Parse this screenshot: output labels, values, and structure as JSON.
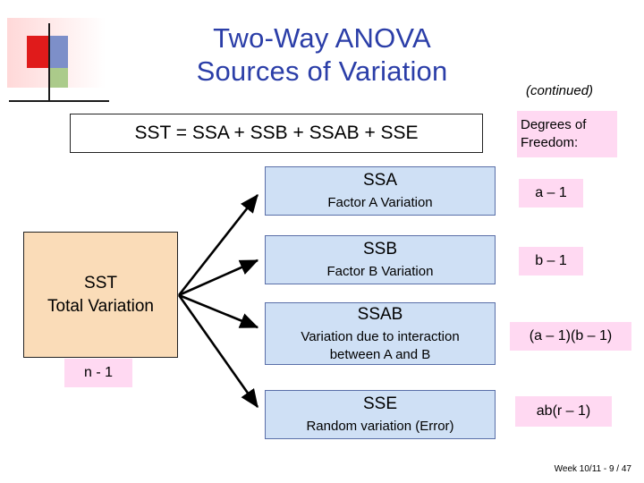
{
  "slide": {
    "title_line1": "Two-Way ANOVA",
    "title_line2": "Sources of Variation",
    "continued_note": "(continued)",
    "equation": "SST = SSA + SSB + SSAB + SSE",
    "footer": "Week 10/11 - 9 / 47"
  },
  "source_box": {
    "name": "SST",
    "description": "Total Variation",
    "df": "n - 1"
  },
  "components": [
    {
      "name": "SSA",
      "description": "Factor A Variation",
      "df": "a – 1"
    },
    {
      "name": "SSB",
      "description": "Factor B Variation",
      "df": "b – 1"
    },
    {
      "name": "SSAB",
      "description_line1": "Variation due to interaction",
      "description_line2": "between A and B",
      "df": "(a – 1)(b – 1)"
    },
    {
      "name": "SSE",
      "description": "Random variation (Error)",
      "df": "ab(r – 1)"
    }
  ],
  "df_header": {
    "line1": "Degrees of",
    "line2": "Freedom:"
  },
  "colors": {
    "title_blue": "#2b3ea8",
    "component_fill": "#cfe0f5",
    "source_fill": "#fadcb8",
    "df_fill": "#ffd9f2"
  }
}
